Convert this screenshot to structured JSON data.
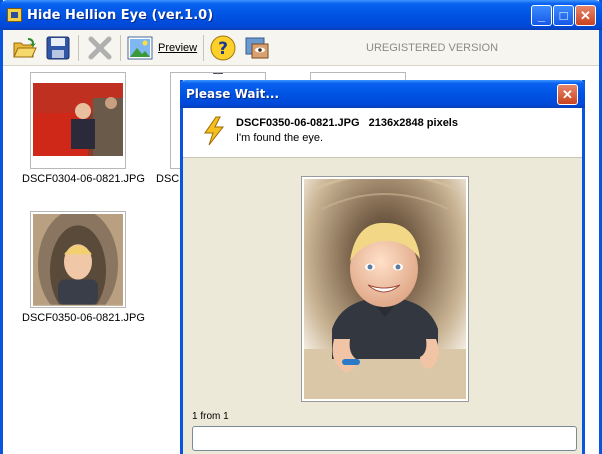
{
  "window": {
    "title": "Hide Hellion Eye (ver.1.0)",
    "minimize": "_",
    "maximize": "□",
    "close": "✕"
  },
  "toolbar": {
    "preview_label": "Preview",
    "unregistered": "UREGISTERED VERSION"
  },
  "thumbnails": [
    {
      "label": "DSCF0304-06-0821.JPG"
    },
    {
      "label": "DSCF"
    },
    {
      "label": "DSCF0350-06-0821.JPG"
    }
  ],
  "dialog": {
    "title": "Please Wait...",
    "close": "✕",
    "filename": "DSCF0350-06-0821.JPG   2136x2848 pixels",
    "status": "I'm found the eye.",
    "progress_label": "1 from 1",
    "progress": 0
  },
  "colors": {
    "titlebar": "#0054e3",
    "dialog_bg": "#ece9d8",
    "toolbar_bg": "#f6f5ef"
  }
}
